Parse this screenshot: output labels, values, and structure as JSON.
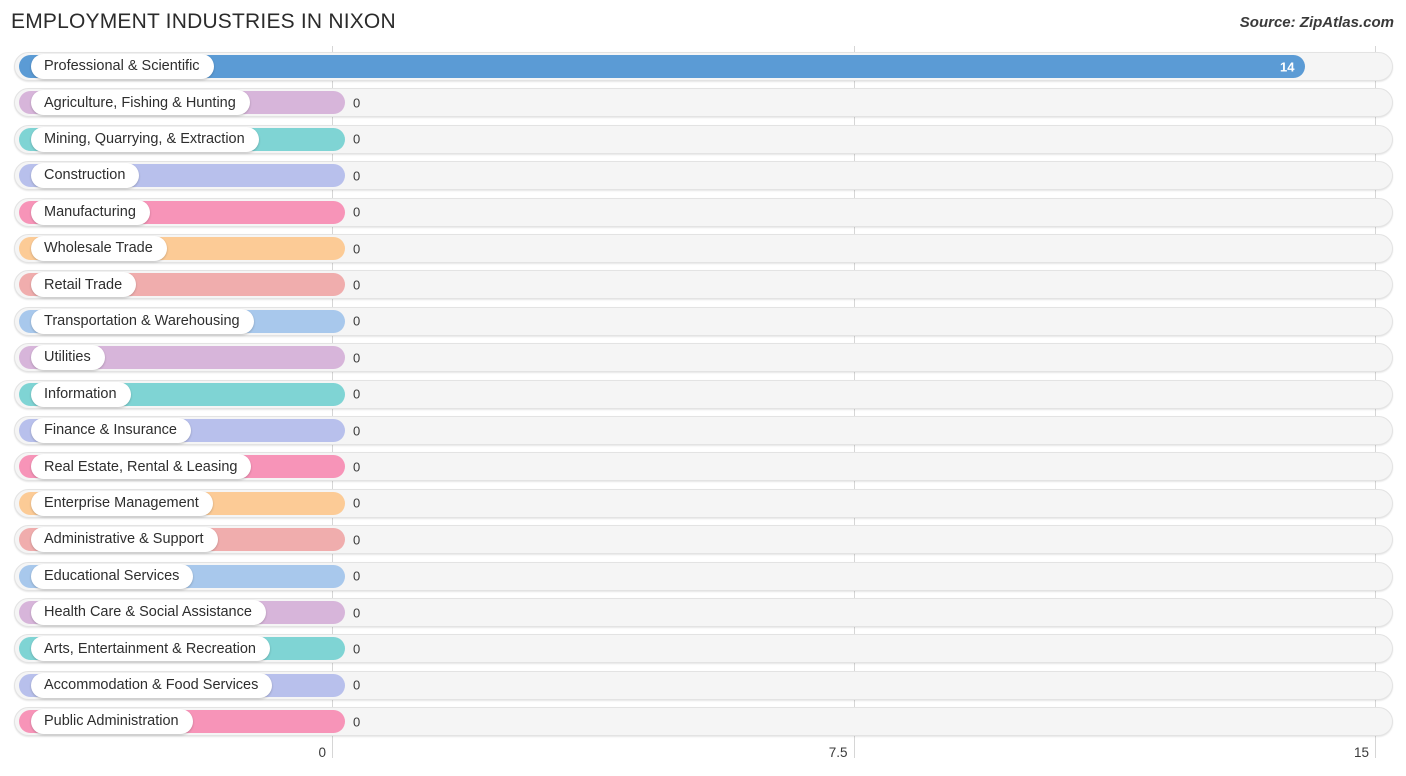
{
  "header": {
    "title": "EMPLOYMENT INDUSTRIES IN NIXON",
    "source": "Source: ZipAtlas.com"
  },
  "axis": {
    "ticks": [
      {
        "label": "0",
        "value": 0
      },
      {
        "label": "7.5",
        "value": 7.5
      },
      {
        "label": "15",
        "value": 15
      }
    ]
  },
  "chart_data": {
    "type": "bar",
    "orientation": "horizontal",
    "title": "EMPLOYMENT INDUSTRIES IN NIXON",
    "subtitle": "",
    "xlabel": "",
    "ylabel": "",
    "xlim": [
      0,
      15
    ],
    "xticks": [
      0,
      7.5,
      15
    ],
    "grid": true,
    "legend": "none",
    "source": "Source: ZipAtlas.com",
    "categories": [
      "Professional & Scientific",
      "Agriculture, Fishing & Hunting",
      "Mining, Quarrying, & Extraction",
      "Construction",
      "Manufacturing",
      "Wholesale Trade",
      "Retail Trade",
      "Transportation & Warehousing",
      "Utilities",
      "Information",
      "Finance & Insurance",
      "Real Estate, Rental & Leasing",
      "Enterprise Management",
      "Administrative & Support",
      "Educational Services",
      "Health Care & Social Assistance",
      "Arts, Entertainment & Recreation",
      "Accommodation & Food Services",
      "Public Administration"
    ],
    "values": [
      14,
      0,
      0,
      0,
      0,
      0,
      0,
      0,
      0,
      0,
      0,
      0,
      0,
      0,
      0,
      0,
      0,
      0,
      0
    ],
    "value_labels": [
      "14",
      "0",
      "0",
      "0",
      "0",
      "0",
      "0",
      "0",
      "0",
      "0",
      "0",
      "0",
      "0",
      "0",
      "0",
      "0",
      "0",
      "0",
      "0"
    ],
    "colors": [
      "#5B9BD5",
      "#D7B5DA",
      "#7FD4D4",
      "#B8C0EC",
      "#F794B8",
      "#FCCB96",
      "#F0ADAD",
      "#A8C8EC",
      "#D7B5DA",
      "#7FD4D4",
      "#B8C0EC",
      "#F794B8",
      "#FCCB96",
      "#F0ADAD",
      "#A8C8EC",
      "#D7B5DA",
      "#7FD4D4",
      "#B8C0EC",
      "#F794B8"
    ]
  }
}
